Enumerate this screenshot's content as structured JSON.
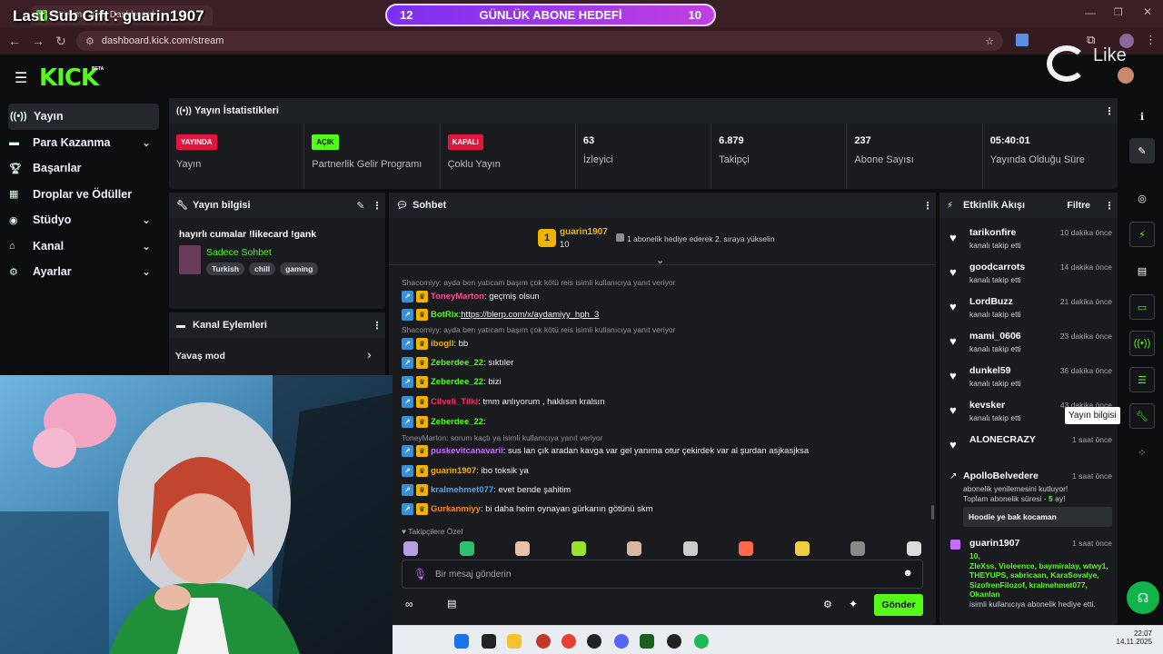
{
  "overlay": {
    "last_sub_gift": "Last Sub Gift : guarin1907",
    "goal": {
      "left": "12",
      "label": "GÜNLÜK ABONE HEDEFİ",
      "right": "10"
    },
    "like_label": "Like"
  },
  "browser": {
    "url": "dashboard.kick.com/stream",
    "tab_title": "Stream - Kick Dashboard"
  },
  "header": {
    "logo": "KICK",
    "beta": "BETA"
  },
  "sidebar": {
    "items": [
      {
        "label": "Yayın",
        "icon": "broadcast-icon",
        "chevron": false
      },
      {
        "label": "Para Kazanma",
        "icon": "money-icon",
        "chevron": true
      },
      {
        "label": "Başarılar",
        "icon": "trophy-icon",
        "chevron": false
      },
      {
        "label": "Droplar ve Ödüller",
        "icon": "gift-icon",
        "chevron": false
      },
      {
        "label": "Stüdyo",
        "icon": "studio-icon",
        "chevron": true
      },
      {
        "label": "Kanal",
        "icon": "channel-icon",
        "chevron": true
      },
      {
        "label": "Ayarlar",
        "icon": "gear-icon",
        "chevron": true
      }
    ]
  },
  "stats": {
    "title": "Yayın İstatistikleri",
    "items": [
      {
        "badge": "YAYINDA",
        "badge_color": "#e0163f",
        "label": "Yayın"
      },
      {
        "badge": "AÇIK",
        "badge_color": "#53fc18",
        "label": "Partnerlik Gelir Programı"
      },
      {
        "badge": "KAPALI",
        "badge_color": "#e0163f",
        "label": "Çoklu Yayın"
      },
      {
        "value": "63",
        "label": "İzleyici"
      },
      {
        "value": "6.879",
        "label": "Takipçi"
      },
      {
        "value": "237",
        "label": "Abone Sayısı"
      },
      {
        "value": "05:40:01",
        "label": "Yayında Olduğu Süre"
      }
    ]
  },
  "stream_info": {
    "title": "Yayın bilgisi",
    "stream_title": "hayırlı cumalar !likecard !gank",
    "category": "Sadece Sohbet",
    "tags": [
      "Turkish",
      "chill",
      "gaming"
    ]
  },
  "channel_actions": {
    "title": "Kanal Eylemleri",
    "slow_mode": "Yavaş mod"
  },
  "chat": {
    "title": "Sohbet",
    "pinned": {
      "user": "guarin1907",
      "count": "10",
      "rank": "1",
      "message": "1 abonelik hediye ederek 2. sıraya yükselin"
    },
    "lines": [
      {
        "type": "reply",
        "text": "Shacomiyy: ayda ben yatıcam başım çok kötü reis isimli kullanıcıya yanıt veriyor"
      },
      {
        "type": "msg",
        "user": "ToneyMarton",
        "color": "#ff4f9a",
        "text": ": geçmiş olsun"
      },
      {
        "type": "msg",
        "user": "BotRix",
        "color": "#53fc18",
        "text": ": ",
        "link": "https://blerp.com/x/aydamiyy_hph_3"
      },
      {
        "type": "reply",
        "text": "Shacomiyy: ayda ben yatıcam başım çok kötü reis isimli kullanıcıya yanıt veriyor"
      },
      {
        "type": "msg",
        "user": "ibogll",
        "color": "#f0b400",
        "text": ": bb"
      },
      {
        "type": "msg",
        "user": "Zeberdee_22",
        "color": "#53fc18",
        "text": ": sıktıler"
      },
      {
        "type": "msg",
        "user": "Zeberdee_22",
        "color": "#53fc18",
        "text": ": bizi"
      },
      {
        "type": "msg",
        "user": "Cilveli_Tilki",
        "color": "#ff2e63",
        "text": ": tmm anlıyorum , haklısın kralsın"
      },
      {
        "type": "msg",
        "user": "Zeberdee_22",
        "color": "#53fc18",
        "text": ":"
      },
      {
        "type": "reply",
        "text": "ToneyMarton: sorum kaçtı ya isimli kullanıcıya yanıt veriyor"
      },
      {
        "type": "msg",
        "user": "puskevitcanavarii",
        "color": "#c86bff",
        "text": ": sus lan çık aradan kavga var gel yanıma otur çekirdek var al şurdan asjkasjksa"
      },
      {
        "type": "msg",
        "user": "guarin1907",
        "color": "#f0b400",
        "text": ": ibo toksik ya"
      },
      {
        "type": "msg",
        "user": "kralmehmet077",
        "color": "#4da3ff",
        "text": ": evet bende şahitim"
      },
      {
        "type": "msg",
        "user": "Gurkanmiyy",
        "color": "#f08a24",
        "text": ": bi daha heim oynayan gürkanın götünü skm"
      }
    ],
    "followers_only": "Takipçilere Özel",
    "input_placeholder": "Bir mesaj gönderin",
    "send_label": "Gönder"
  },
  "activity": {
    "title": "Etkinlik Akışı",
    "filter": "Filtre",
    "events": [
      {
        "name": "tarikonfire",
        "time": "10 dakika önce",
        "action": "kanalı takip etti"
      },
      {
        "name": "goodcarrots",
        "time": "14 dakika önce",
        "action": "kanalı takip etti"
      },
      {
        "name": "LordBuzz",
        "time": "21 dakika önce",
        "action": "kanalı takip etti"
      },
      {
        "name": "mami_0606",
        "time": "23 dakika önce",
        "action": "kanalı takip etti"
      },
      {
        "name": "dunkel59",
        "time": "36 dakika önce",
        "action": "kanalı takip etti"
      },
      {
        "name": "kevsker",
        "time": "43 dakika önce",
        "action": "kanalı takip etti"
      },
      {
        "name": "ALONECRAZY",
        "time": "1 saat önce",
        "action": ""
      }
    ],
    "resub": {
      "name": "ApolloBelvedere",
      "time": "1 saat önce",
      "line1": "abonelik yenilemesini kutluyor!",
      "line2_pre": "Toplam abonelik süresi - ",
      "months": "5",
      "line2_post": " ay!",
      "message": "Hoodie ye bak kocaman"
    },
    "gift": {
      "name": "guarin1907",
      "time": "1 saat önce",
      "count": "10",
      "recipients": "ZleXss, Violeence, baymiralay, wtwy1, THEYUPS, sabricaan, KaraSovalye, SizofrenFilozof, kralmehmet077, Okanlan",
      "tail": "isimli kullanıcıya abonelik hediye etti."
    }
  },
  "rail": {
    "tooltip": "Yayın bilgisi"
  },
  "taskbar": {
    "time": "22:07",
    "date": "14.11.2025"
  }
}
